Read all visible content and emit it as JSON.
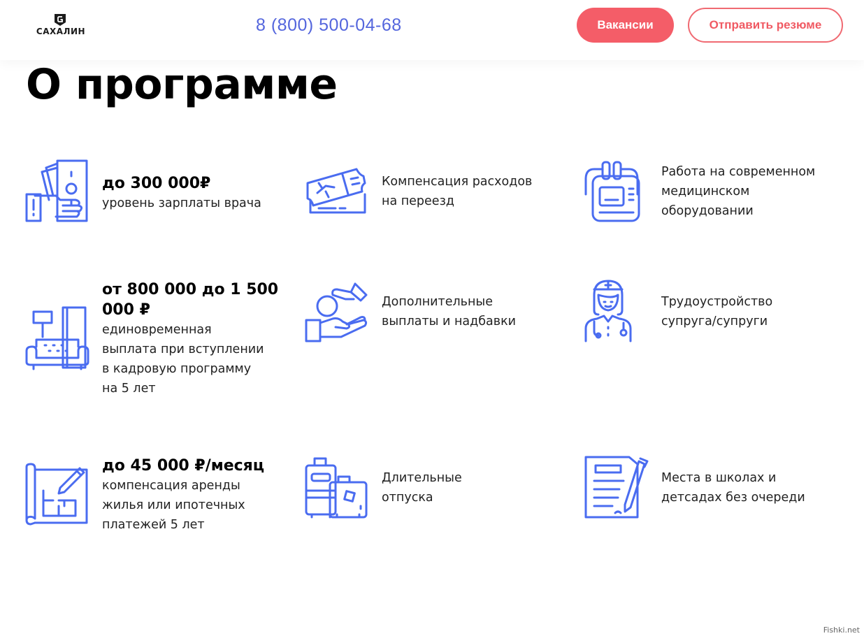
{
  "header": {
    "logo_text": "САХАЛИН",
    "phone": "8 (800) 500-04-68",
    "vacancies_label": "Вакансии",
    "resume_label": "Отправить резюме"
  },
  "page_title": "О программе",
  "accent_color": "#4a6cf0",
  "features": [
    {
      "icon": "salary-icon",
      "heading": "до 300 000₽",
      "body": "уровень зарплаты врача"
    },
    {
      "icon": "ticket-icon",
      "heading": "",
      "body": "Компенсация расходов\nна переезд"
    },
    {
      "icon": "medical-device-icon",
      "heading": "",
      "body": "Работа на современном\nмедицинском\nоборудовании"
    },
    {
      "icon": "furniture-icon",
      "heading": "от 800 000 до 1 500\n000 ₽",
      "body": "единовременная\nвыплата при вступлении\nв кадровую программу\nна 5 лет"
    },
    {
      "icon": "coin-hands-icon",
      "heading": "",
      "body": "Дополнительные\nвыплаты и надбавки"
    },
    {
      "icon": "nurse-icon",
      "heading": "",
      "body": "Трудоустройство\nсупруга/супруги"
    },
    {
      "icon": "blueprint-icon",
      "heading": "до 45 000 ₽/месяц",
      "body": "компенсация аренды\nжилья или ипотечных\nплатежей 5 лет"
    },
    {
      "icon": "luggage-icon",
      "heading": "",
      "body": "Длительные\nотпуска"
    },
    {
      "icon": "document-pen-icon",
      "heading": "",
      "body": "Места в школах и\nдетсадах без очереди"
    }
  ],
  "watermark": "Fishki.net"
}
